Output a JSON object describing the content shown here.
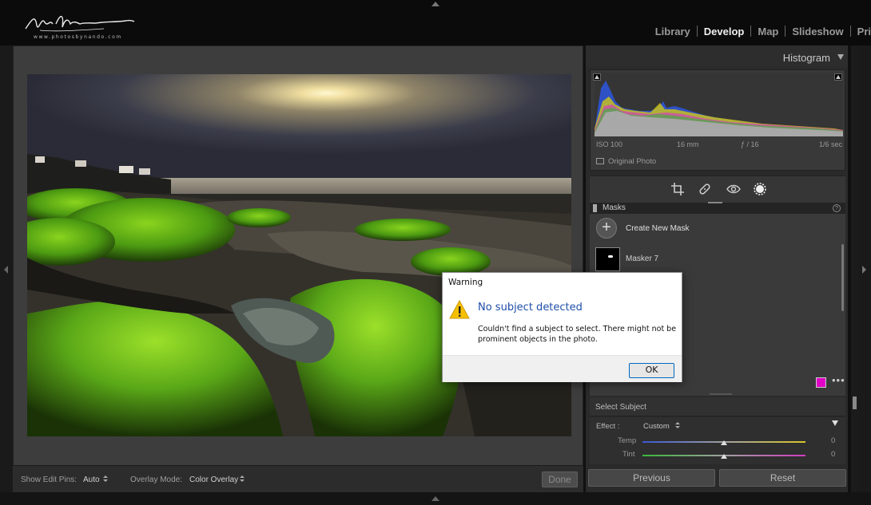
{
  "topbar": {
    "logo_subtext": "www.photosbynando.com",
    "modules": [
      {
        "label": "Library",
        "active": false
      },
      {
        "label": "Develop",
        "active": true
      },
      {
        "label": "Map",
        "active": false
      },
      {
        "label": "Slideshow",
        "active": false
      },
      {
        "label": "Pri",
        "active": false
      }
    ]
  },
  "center": {
    "photo_alt": "Moss-covered rocks on a beach at sunset",
    "toolbar": {
      "edit_pins_label": "Show Edit Pins:",
      "edit_pins_value": "Auto",
      "overlay_label": "Overlay Mode:",
      "overlay_value": "Color Overlay",
      "done_label": "Done"
    }
  },
  "histogram": {
    "title": "Histogram",
    "iso": "ISO 100",
    "focal": "16 mm",
    "aperture": "ƒ / 16",
    "shutter": "1/6 sec",
    "original_photo_label": "Original Photo"
  },
  "masks": {
    "header": "Masks",
    "create_label": "Create New Mask",
    "mask_name": "Masker 7",
    "overlay_color": "#e000c8"
  },
  "select_subject": {
    "title": "Select Subject",
    "effect_label": "Effect :",
    "effect_value": "Custom",
    "sliders": [
      {
        "label": "Temp",
        "value": "0",
        "position": 0.5
      },
      {
        "label": "Tint",
        "value": "0",
        "position": 0.5
      }
    ]
  },
  "footer_buttons": {
    "previous": "Previous",
    "reset": "Reset"
  },
  "dialog": {
    "title": "Warning",
    "heading": "No subject detected",
    "body": "Couldn't find a subject to select. There might not be prominent objects in the photo.",
    "ok_label": "OK"
  }
}
